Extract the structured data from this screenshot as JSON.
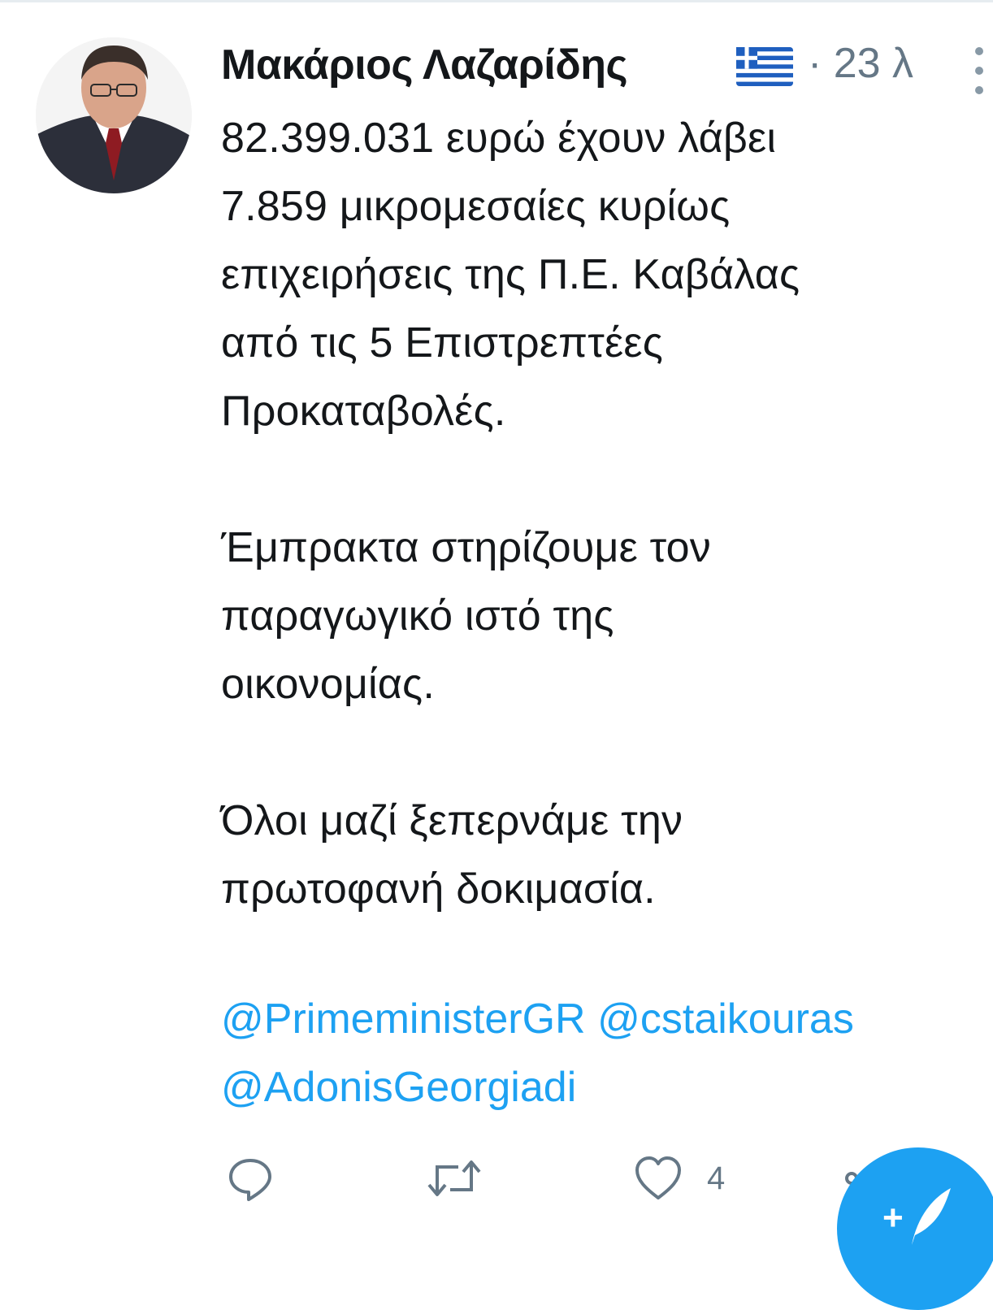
{
  "tweet": {
    "author_name": "Μακάριος Λαζαρίδης",
    "badge": "greek-flag-emoji",
    "time": "· 23 λ",
    "paragraphs": [
      [
        "82.399.031 ευρώ έχουν λάβει",
        "7.859 μικρομεσαίες κυρίως",
        "επιχειρήσεις της Π.Ε. Καβάλας",
        "από τις 5 Επιστρεπτέες",
        "Προκαταβολές."
      ],
      [
        "Έμπρακτα στηρίζουμε τον",
        "παραγωγικό ιστό της",
        "οικονομίας."
      ],
      [
        "Όλοι μαζί ξεπερνάμε την",
        "πρωτοφανή δοκιμασία."
      ]
    ],
    "mentions": [
      "@PrimeministerGR",
      "@cstaikouras",
      "@AdonisGeorgiadi"
    ],
    "like_count": "4"
  },
  "colors": {
    "text": "#14171a",
    "secondary": "#657786",
    "link": "#1da1f2",
    "fab": "#1da1f2"
  },
  "icons": [
    "avatar-photo",
    "greek-flag-icon",
    "more-options-icon",
    "reply-icon",
    "retweet-icon",
    "like-icon",
    "share-icon",
    "compose-tweet-icon"
  ]
}
